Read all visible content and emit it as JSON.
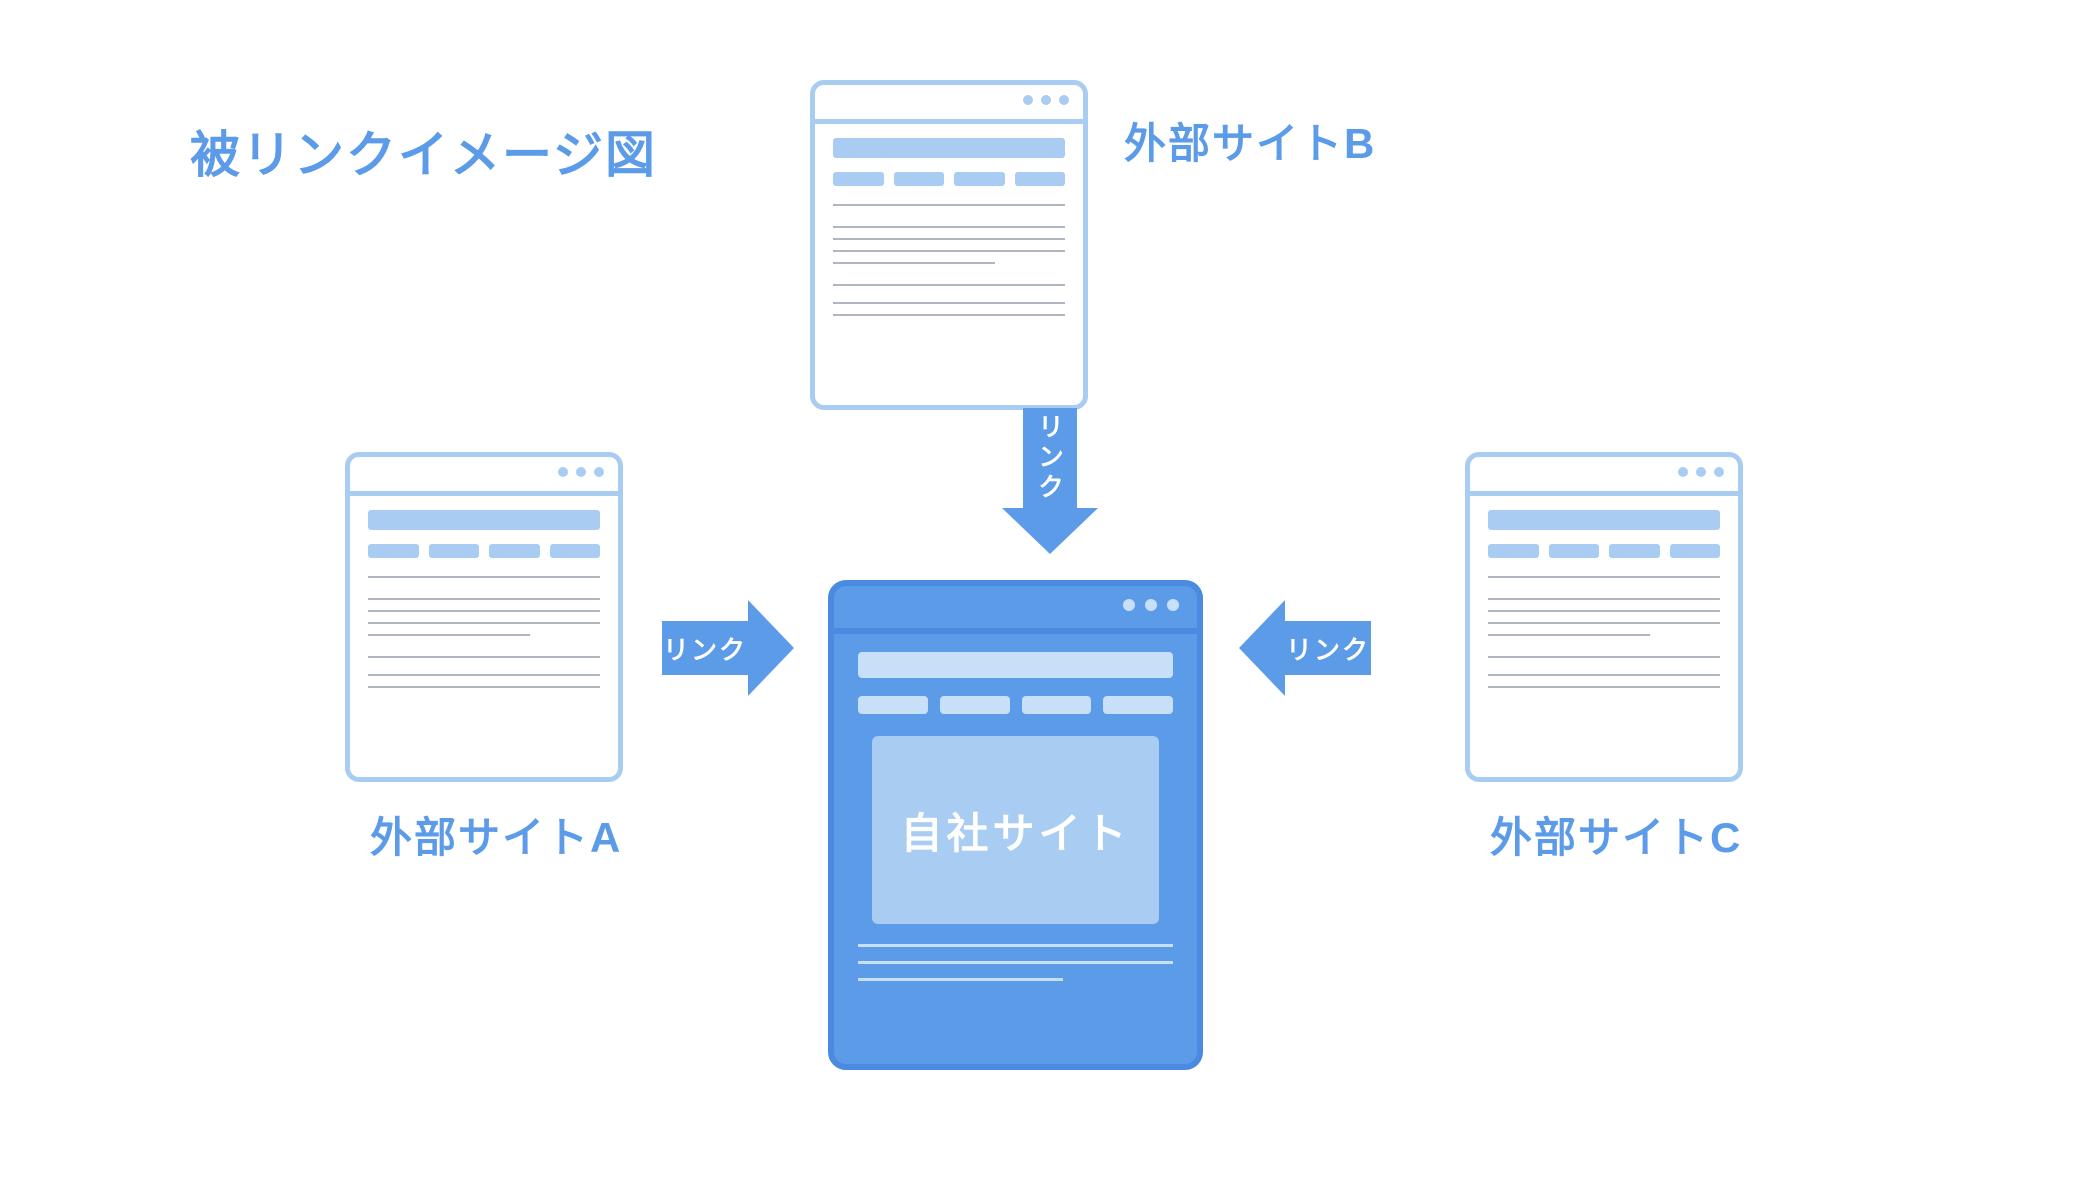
{
  "title": "被リンクイメージ図",
  "arrows": {
    "left": {
      "label": "リンク"
    },
    "top": {
      "label": "リンク"
    },
    "right": {
      "label": "リンク"
    }
  },
  "external": {
    "a": {
      "label": "外部サイトA"
    },
    "b": {
      "label": "外部サイトB"
    },
    "c": {
      "label": "外部サイトC"
    }
  },
  "own_site": {
    "label": "自社サイト"
  },
  "colors": {
    "blue_600": "#4a8ae0",
    "blue_500": "#5c9be8",
    "blue_300": "#a9ccf2",
    "blue_200": "#c8dff8"
  }
}
